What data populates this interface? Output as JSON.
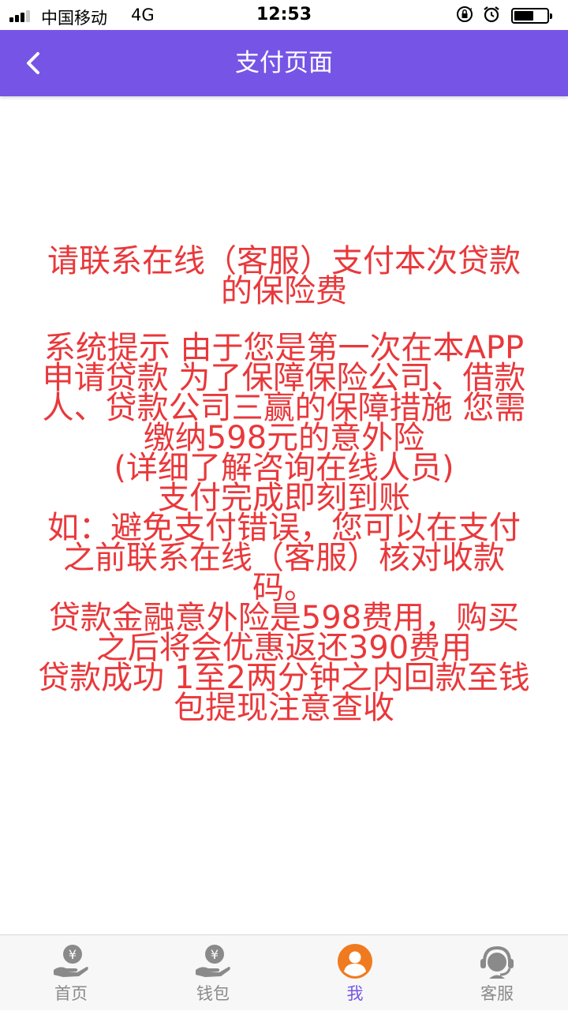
{
  "status_bar": {
    "carrier": "中国移动",
    "network": "4G",
    "time": "12:53"
  },
  "nav": {
    "back_icon": "chevron-left-icon",
    "title": "支付页面"
  },
  "notice": {
    "color": "#e9383b",
    "heading_lines": [
      "请联系在线（客服）支付本次贷款",
      "的保险费"
    ],
    "body_lines": [
      "系统提示 由于您是第一次在本APP",
      "申请贷款 为了保障保险公司、借款",
      "人、贷款公司三赢的保障措施 您需",
      "缴纳598元的意外险",
      "(详细了解咨询在线人员)",
      "支付完成即刻到账",
      "如：避免支付错误，您可以在支付",
      "之前联系在线（客服）核对收款",
      "码。",
      "贷款金融意外险是598费用，购买",
      "之后将会优惠返还390费用",
      "贷款成功 1至2两分钟之内回款至钱",
      "包提现注意查收"
    ]
  },
  "tab_bar": {
    "tabs": [
      {
        "label": "首页",
        "icon": "yen-hand-icon",
        "active": false
      },
      {
        "label": "钱包",
        "icon": "yen-hand-icon",
        "active": false
      },
      {
        "label": "我",
        "icon": "user-avatar-icon",
        "active": true
      },
      {
        "label": "客服",
        "icon": "customer-service-icon",
        "active": false
      }
    ],
    "active_color": "#7655e6",
    "inactive_color": "#8a8a8a"
  },
  "colors": {
    "nav_bg": "#7655e6",
    "active_tab_icon": "#f07a1f"
  }
}
